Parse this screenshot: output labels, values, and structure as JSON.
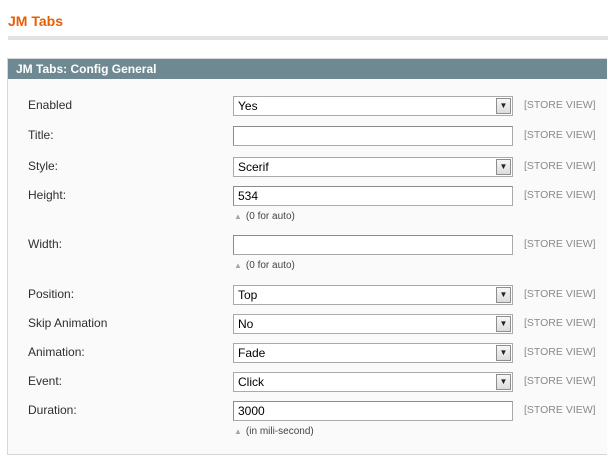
{
  "page": {
    "title": "JM Tabs"
  },
  "section": {
    "title": "JM Tabs: Config General"
  },
  "fields": {
    "enabled": {
      "label": "Enabled",
      "value": "Yes",
      "scope": "[STORE VIEW]"
    },
    "title": {
      "label": "Title:",
      "value": "",
      "scope": "[STORE VIEW]"
    },
    "style": {
      "label": "Style:",
      "value": "Scerif",
      "scope": "[STORE VIEW]"
    },
    "height": {
      "label": "Height:",
      "value": "534",
      "scope": "[STORE VIEW]",
      "note": "(0 for auto)"
    },
    "width": {
      "label": "Width:",
      "value": "",
      "scope": "[STORE VIEW]",
      "note": "(0 for auto)"
    },
    "position": {
      "label": "Position:",
      "value": "Top",
      "scope": "[STORE VIEW]"
    },
    "skip": {
      "label": "Skip Animation",
      "value": "No",
      "scope": "[STORE VIEW]"
    },
    "animation": {
      "label": "Animation:",
      "value": "Fade",
      "scope": "[STORE VIEW]"
    },
    "event": {
      "label": "Event:",
      "value": "Click",
      "scope": "[STORE VIEW]"
    },
    "duration": {
      "label": "Duration:",
      "value": "3000",
      "scope": "[STORE VIEW]",
      "note": "(in mili-second)"
    }
  },
  "icons": {
    "dropdown": "chevron-down-icon",
    "note": "triangle-up-icon"
  },
  "colors": {
    "page_title": "#eb5e00",
    "section_header": "#6f8992",
    "scope_text": "#8a8a8a"
  }
}
